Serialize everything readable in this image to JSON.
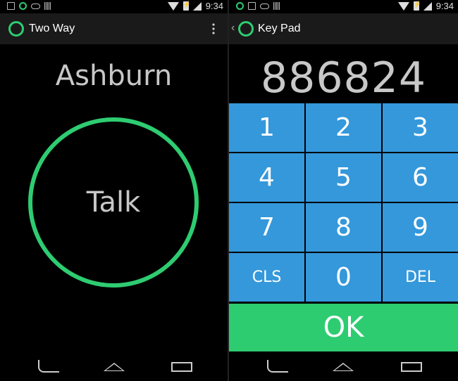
{
  "colors": {
    "accent_green": "#2ecc71",
    "key_blue": "#3498db",
    "text_gray": "#c8c8c8"
  },
  "left_screen": {
    "status_bar": {
      "time": "9:34",
      "icons": [
        "image-icon",
        "app-ring-icon",
        "voicemail-icon",
        "signal-bars-icon",
        "wifi-icon",
        "battery-icon",
        "signal-icon"
      ]
    },
    "action_bar": {
      "title": "Two Way",
      "menu_icon": "overflow-menu-icon"
    },
    "location": "Ashburn",
    "talk_button": "Talk"
  },
  "right_screen": {
    "status_bar": {
      "time": "9:34",
      "icons": [
        "app-ring-icon",
        "image-icon",
        "voicemail-icon",
        "signal-bars-icon",
        "wifi-icon",
        "battery-icon",
        "signal-icon"
      ]
    },
    "action_bar": {
      "title": "Key Pad"
    },
    "entry": "886824",
    "keys": [
      "1",
      "2",
      "3",
      "4",
      "5",
      "6",
      "7",
      "8",
      "9",
      "CLS",
      "0",
      "DEL"
    ],
    "ok_label": "OK"
  }
}
